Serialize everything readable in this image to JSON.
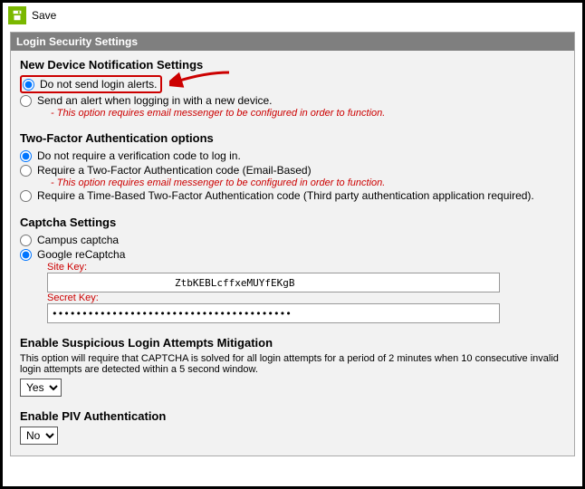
{
  "toolbar": {
    "save_label": "Save"
  },
  "panel": {
    "title": "Login Security Settings"
  },
  "sections": {
    "newDevice": {
      "title": "New Device Notification Settings",
      "opt1": "Do not send login alerts.",
      "opt2": "Send an alert when logging in with a new device.",
      "opt2_note": "- This option requires email messenger to be configured in order to function."
    },
    "twoFactor": {
      "title": "Two-Factor Authentication options",
      "opt1": "Do not require a verification code to log in.",
      "opt2": "Require a Two-Factor Authentication code (Email-Based)",
      "opt2_note": "- This option requires email messenger to be configured in order to function.",
      "opt3": "Require a Time-Based Two-Factor Authentication code (Third party authentication application required)."
    },
    "captcha": {
      "title": "Captcha Settings",
      "opt1": "Campus captcha",
      "opt2": "Google reCaptcha",
      "siteKeyLabel": "Site Key:",
      "siteKeyValue": "ZtbKEBLcffxeMUYfEKgB",
      "secretKeyLabel": "Secret Key:",
      "secretKeyValue": "••••••••••••••••••••••••••••••••••••••••"
    },
    "suspicious": {
      "title": "Enable Suspicious Login Attempts Mitigation",
      "desc": "This option will require that CAPTCHA is solved for all login attempts for a period of 2 minutes when 10 consecutive invalid login attempts are detected within a 5 second window.",
      "value": "Yes"
    },
    "piv": {
      "title": "Enable PIV Authentication",
      "value": "No"
    }
  }
}
